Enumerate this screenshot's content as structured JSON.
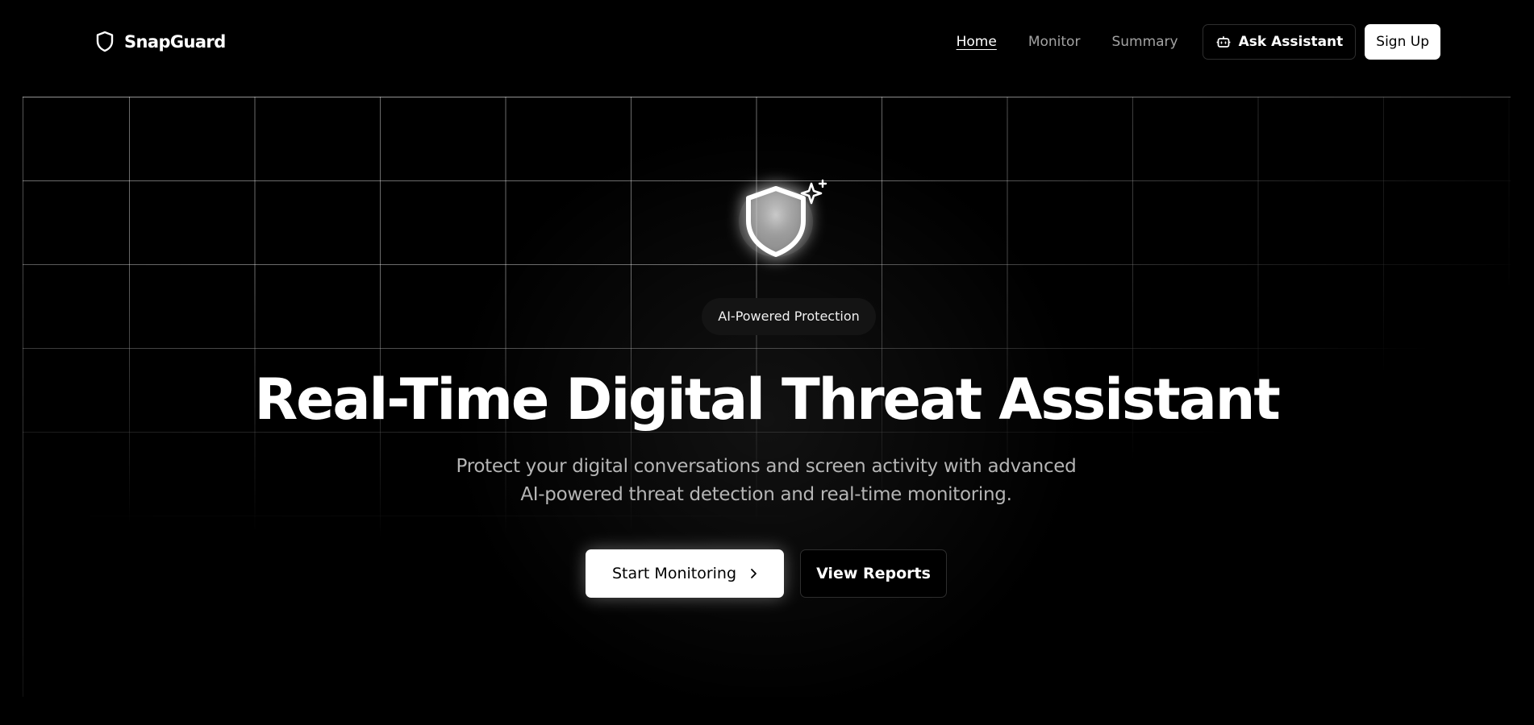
{
  "brand": {
    "name": "SnapGuard",
    "icon": "shield-icon"
  },
  "nav": {
    "items": [
      {
        "label": "Home",
        "active": true
      },
      {
        "label": "Monitor",
        "active": false
      },
      {
        "label": "Summary",
        "active": false
      }
    ],
    "ask_assistant": {
      "label": "Ask Assistant",
      "icon": "bot-icon"
    },
    "sign_up": {
      "label": "Sign Up"
    }
  },
  "hero": {
    "icon": "shield-sparkles-icon",
    "badge": "AI-Powered Protection",
    "title": "Real-Time Digital Threat Assistant",
    "subtitle_line1": "Protect your digital conversations and screen activity with advanced",
    "subtitle_line2": "AI-powered threat detection and real-time monitoring.",
    "primary_cta": {
      "label": "Start Monitoring",
      "icon": "chevron-right-icon"
    },
    "secondary_cta": {
      "label": "View Reports"
    }
  },
  "colors": {
    "background": "#000000",
    "text_primary": "#ffffff",
    "text_muted": "#a3a3a3",
    "button_light": "#ffffff",
    "border": "#2e2e2e"
  }
}
